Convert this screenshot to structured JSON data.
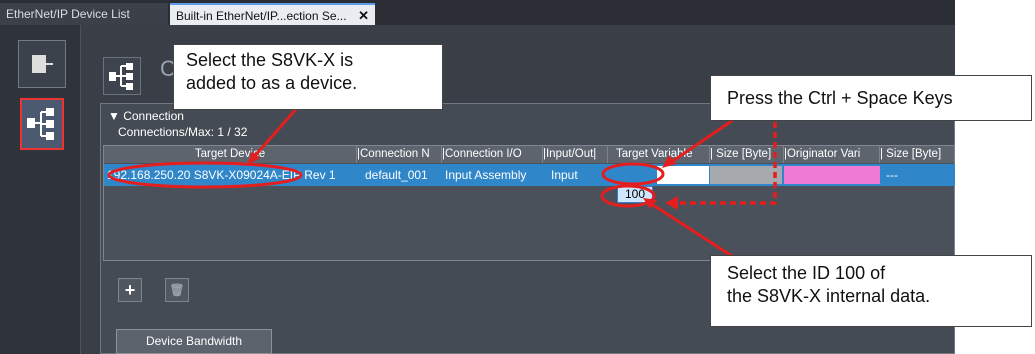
{
  "tabs": [
    {
      "label": "EtherNet/IP Device List"
    },
    {
      "label": "Built-in EtherNet/IP...ection Se...",
      "close": "✕"
    }
  ],
  "header": {
    "partial_title": "C"
  },
  "connections": {
    "section_label": "▼ Connection",
    "count_label": "Connections/Max: 1 / 32",
    "columns": [
      "Target Device",
      "|Connection N",
      "|Connection I/O",
      "|Input/Out|",
      "Target Variable",
      "| Size [Byte]",
      "|Originator Vari",
      "| Size [Byte]"
    ],
    "rows": [
      {
        "target_device": "192.168.250.20 S8VK-X09024A-EIP Rev 1",
        "connection_name": "default_001",
        "connection_io": "Input Assembly",
        "io_type": "Input",
        "target_variable": "",
        "size": "",
        "originator_variable": "",
        "orig_size": "---"
      }
    ],
    "dropdown_option": "100"
  },
  "buttons": {
    "add": "+",
    "delete": "🗑",
    "bandwidth": "Device Bandwidth"
  },
  "callouts": {
    "select_device": [
      "Select the S8VK-X is",
      "added to as a device."
    ],
    "press_keys": "Press the Ctrl + Space Keys",
    "select_id": [
      "Select the ID 100 of",
      "the S8VK-X internal data."
    ]
  },
  "colors": {
    "annotation_red": "#e41e1e",
    "selected_row": "#2f86c9",
    "pink_cell": "#ef7ad4"
  }
}
